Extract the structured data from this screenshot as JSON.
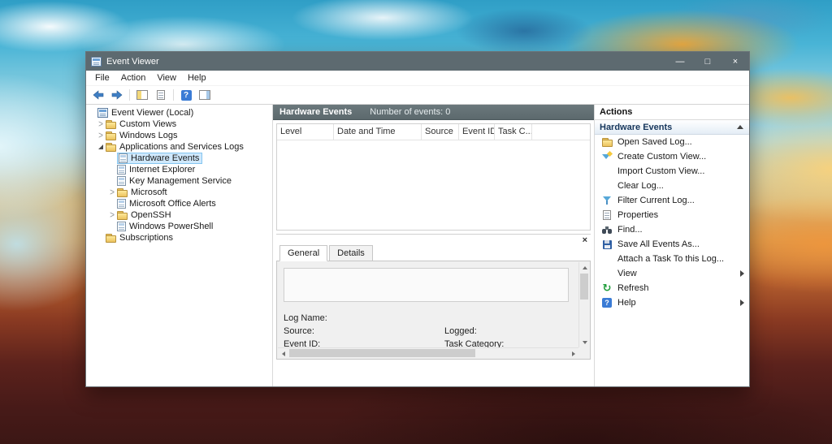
{
  "colors": {
    "titlebar": "#5d6a70",
    "selection_bg": "#cfe8fc",
    "selection_border": "#84c5f0",
    "accent_blue": "#3a7bd5",
    "actions_group_text": "#16365c"
  },
  "window": {
    "title": "Event Viewer",
    "controls": [
      {
        "name": "minimize",
        "glyph": "—"
      },
      {
        "name": "maximize",
        "glyph": "□"
      },
      {
        "name": "close",
        "glyph": "×"
      }
    ]
  },
  "menubar": {
    "items": [
      "File",
      "Action",
      "View",
      "Help"
    ]
  },
  "toolbar": {
    "icons": [
      "back-arrow",
      "forward-arrow",
      "show-console-tree",
      "properties-document",
      "help-question",
      "show-action-pane"
    ]
  },
  "tree": {
    "items": [
      {
        "label": "Event Viewer (Local)",
        "icon": "event-viewer"
      },
      {
        "label": "Custom Views",
        "icon": "folder",
        "expander": "collapsed"
      },
      {
        "label": "Windows Logs",
        "icon": "folder",
        "expander": "collapsed"
      },
      {
        "label": "Applications and Services Logs",
        "icon": "folder",
        "expander": "expanded"
      },
      {
        "label": "Hardware Events",
        "icon": "event-log",
        "selected": true
      },
      {
        "label": "Internet Explorer",
        "icon": "event-log"
      },
      {
        "label": "Key Management Service",
        "icon": "event-log"
      },
      {
        "label": "Microsoft",
        "icon": "folder",
        "expander": "collapsed"
      },
      {
        "label": "Microsoft Office Alerts",
        "icon": "event-log"
      },
      {
        "label": "OpenSSH",
        "icon": "folder",
        "expander": "collapsed"
      },
      {
        "label": "Windows PowerShell",
        "icon": "event-log"
      },
      {
        "label": "Subscriptions",
        "icon": "folder"
      }
    ]
  },
  "main": {
    "title": "Hardware Events",
    "meta": "Number of events: 0",
    "columns": [
      "Level",
      "Date and Time",
      "Source",
      "Event ID",
      "Task C..."
    ],
    "rows": []
  },
  "preview": {
    "close_glyph": "×",
    "tabs": [
      "General",
      "Details"
    ],
    "fields": {
      "log_name": "Log Name:",
      "source": "Source:",
      "logged": "Logged:",
      "event_id": "Event ID:",
      "task_category": "Task Category:"
    }
  },
  "actions": {
    "title": "Actions",
    "group": "Hardware Events",
    "items": [
      {
        "label": "Open Saved Log...",
        "icon": "open-folder"
      },
      {
        "label": "Create Custom View...",
        "icon": "create-view-funnel"
      },
      {
        "label": "Import Custom View...",
        "icon": ""
      },
      {
        "label": "Clear Log...",
        "icon": ""
      },
      {
        "label": "Filter Current Log...",
        "icon": "funnel"
      },
      {
        "label": "Properties",
        "icon": "properties-document"
      },
      {
        "label": "Find...",
        "icon": "binoculars"
      },
      {
        "label": "Save All Events As...",
        "icon": "save-disk"
      },
      {
        "label": "Attach a Task To this Log...",
        "icon": ""
      },
      {
        "label": "View",
        "icon": "",
        "submenu": true
      },
      {
        "label": "Refresh",
        "icon": "refresh"
      },
      {
        "label": "Help",
        "icon": "help",
        "submenu": true
      }
    ]
  }
}
